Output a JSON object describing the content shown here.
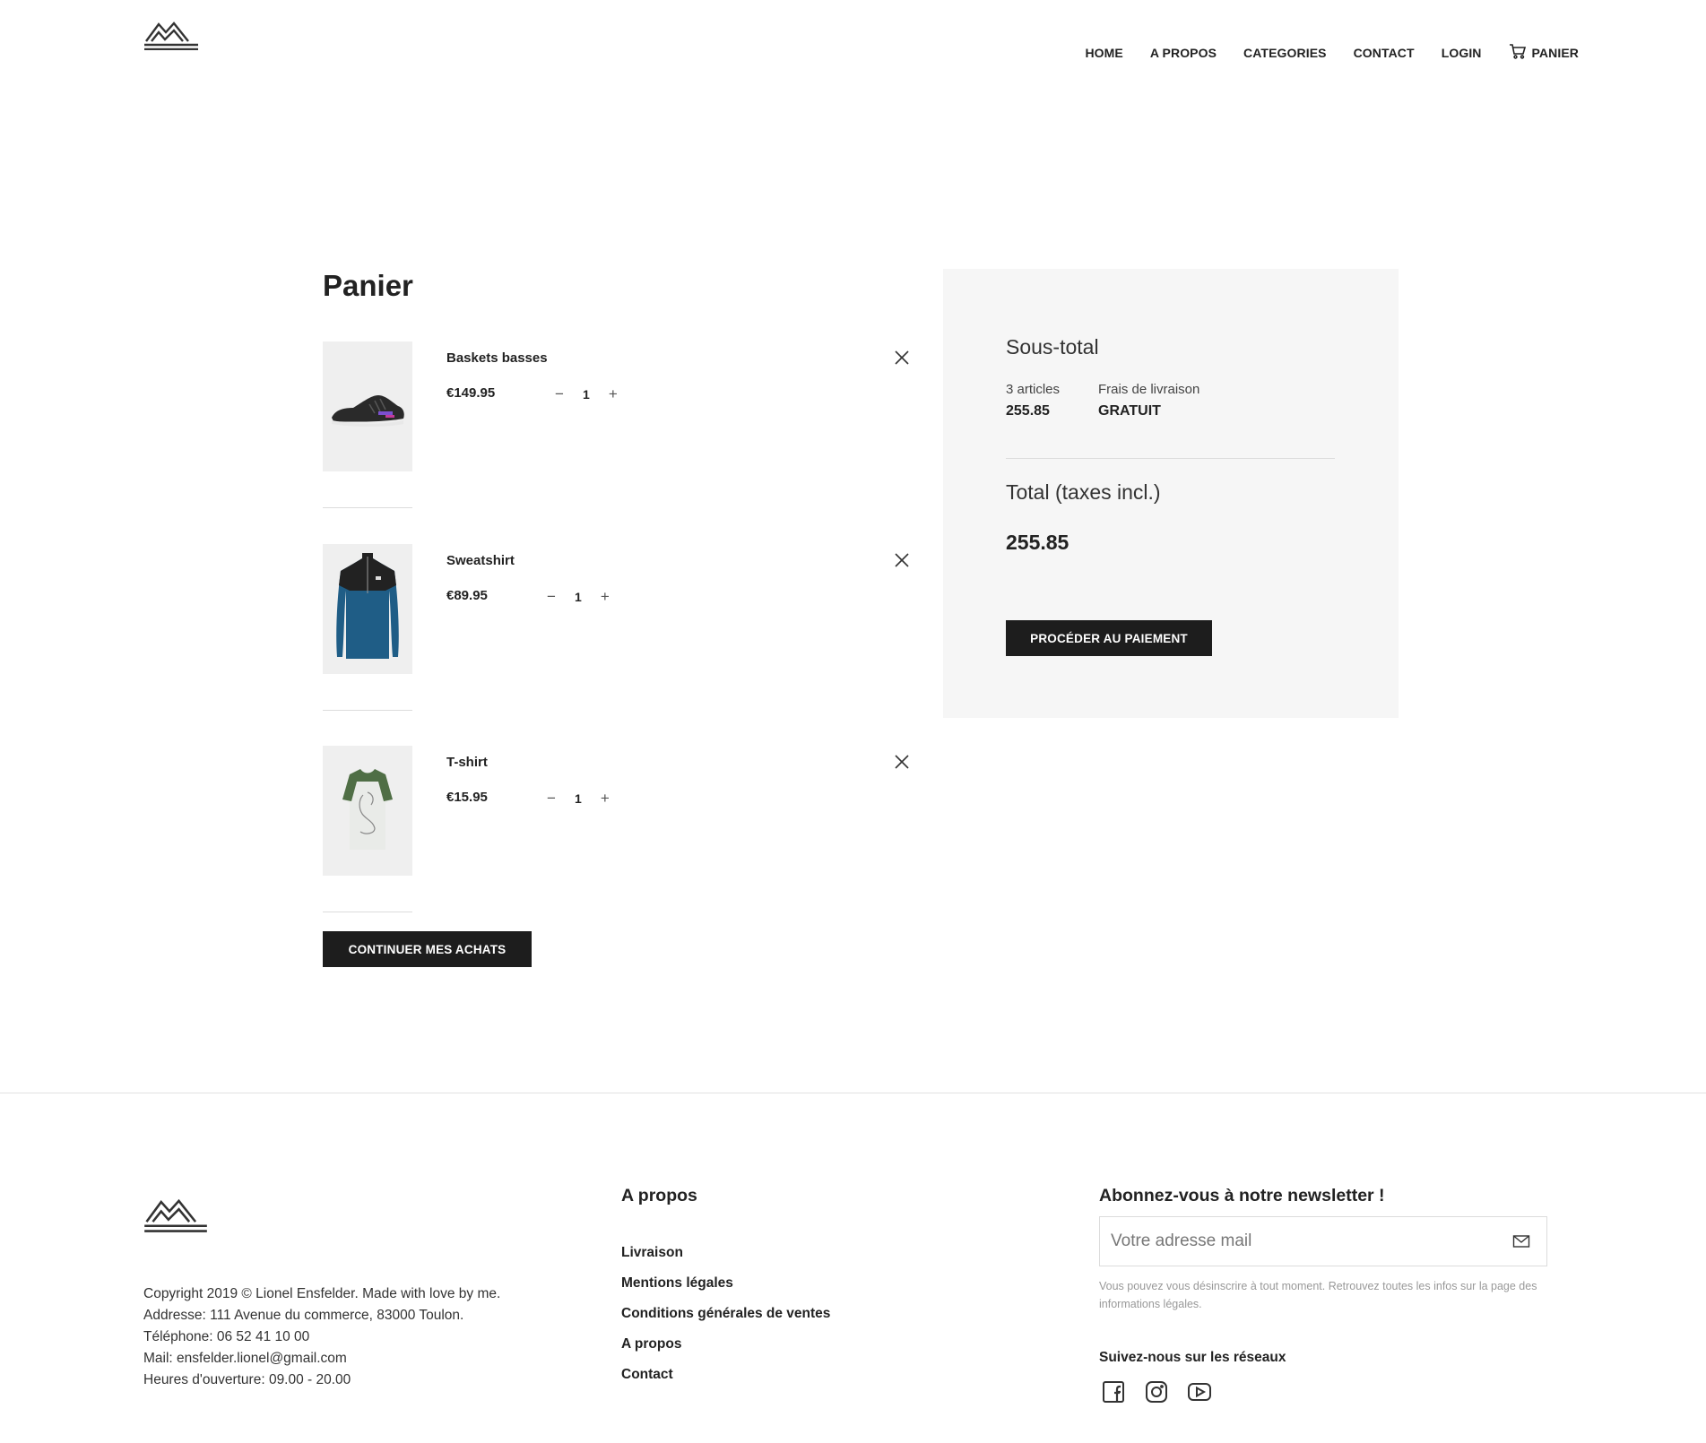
{
  "header": {
    "nav": [
      {
        "label": "HOME"
      },
      {
        "label": "A PROPOS"
      },
      {
        "label": "CATEGORIES"
      },
      {
        "label": "CONTACT"
      },
      {
        "label": "LOGIN"
      },
      {
        "label": "PANIER",
        "icon": "cart-icon"
      }
    ]
  },
  "cart": {
    "title": "Panier",
    "items": [
      {
        "name": "Baskets basses",
        "price": "€149.95",
        "quantity": "1",
        "image": "sneaker-image"
      },
      {
        "name": "Sweatshirt",
        "price": "€89.95",
        "quantity": "1",
        "image": "sweatshirt-image"
      },
      {
        "name": "T-shirt",
        "price": "€15.95",
        "quantity": "1",
        "image": "tshirt-image"
      }
    ],
    "qty_minus": "−",
    "qty_plus": "+",
    "continue_label": "CONTINUER MES ACHATS"
  },
  "summary": {
    "subtotal_title": "Sous-total",
    "articles_label": "3 articles",
    "articles_value": "255.85",
    "shipping_label": "Frais de livraison",
    "shipping_value": "GRATUIT",
    "total_label": "Total (taxes incl.)",
    "total_value": "255.85",
    "pay_label": "PROCÉDER AU PAIEMENT"
  },
  "footer": {
    "copyright": "Copyright 2019 © Lionel Ensfelder. Made with love by me.",
    "address": "Addresse: 111 Avenue du commerce, 83000 Toulon.",
    "phone": "Téléphone: 06 52 41 10 00",
    "mail": "Mail: ensfelder.lionel@gmail.com",
    "hours": "Heures d'ouverture: 09.00 - 20.00",
    "about_heading": "A propos",
    "links": [
      "Livraison",
      "Mentions légales",
      "Conditions générales de ventes",
      "A propos",
      "Contact"
    ],
    "newsletter_heading": "Abonnez-vous à notre newsletter !",
    "newsletter_placeholder": "Votre adresse mail",
    "newsletter_note": "Vous pouvez vous désinscrire à tout moment. Retrouvez toutes les infos sur la page des informations légales.",
    "social_heading": "Suivez-nous sur les réseaux",
    "socials": [
      "facebook-icon",
      "instagram-icon",
      "youtube-icon"
    ]
  },
  "colors": {
    "text": "#222222",
    "button_bg": "#1d1d1d",
    "summary_bg": "#f6f6f6",
    "image_bg": "#efefef"
  }
}
